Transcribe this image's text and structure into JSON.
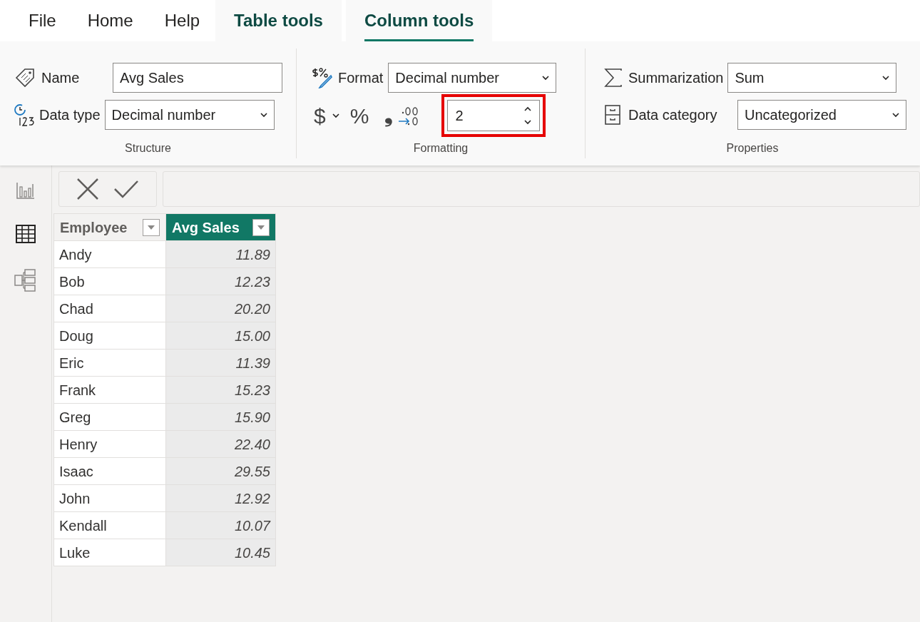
{
  "tabs": [
    {
      "label": "File",
      "selected": false,
      "kind": "normal"
    },
    {
      "label": "Home",
      "selected": false,
      "kind": "normal"
    },
    {
      "label": "Help",
      "selected": false,
      "kind": "normal"
    },
    {
      "label": "Table tools",
      "selected": false,
      "kind": "contextual"
    },
    {
      "label": "Column tools",
      "selected": true,
      "kind": "contextual"
    }
  ],
  "ribbon": {
    "structure": {
      "title": "Structure",
      "name_label": "Name",
      "name_value": "Avg Sales",
      "data_type_label": "Data type",
      "data_type_value": "Decimal number"
    },
    "formatting": {
      "title": "Formatting",
      "format_label": "Format",
      "format_value": "Decimal number",
      "currency_symbol": "$",
      "percent_symbol": "%",
      "comma_symbol": "❟",
      "decimal_places": "2",
      "decimal_places_highlighted": true
    },
    "properties": {
      "title": "Properties",
      "summarization_label": "Summarization",
      "summarization_value": "Sum",
      "data_category_label": "Data category",
      "data_category_value": "Uncategorized"
    }
  },
  "nav": [
    {
      "kind": "report",
      "selected": false
    },
    {
      "kind": "table",
      "selected": true
    },
    {
      "kind": "model",
      "selected": false
    }
  ],
  "table": {
    "columns": [
      {
        "label": "Employee",
        "selected": false
      },
      {
        "label": "Avg Sales",
        "selected": true
      }
    ],
    "rows": [
      [
        "Andy",
        "11.89"
      ],
      [
        "Bob",
        "12.23"
      ],
      [
        "Chad",
        "20.20"
      ],
      [
        "Doug",
        "15.00"
      ],
      [
        "Eric",
        "11.39"
      ],
      [
        "Frank",
        "15.23"
      ],
      [
        "Greg",
        "15.90"
      ],
      [
        "Henry",
        "22.40"
      ],
      [
        "Isaac",
        "29.55"
      ],
      [
        "John",
        "12.92"
      ],
      [
        "Kendall",
        "10.07"
      ],
      [
        "Luke",
        "10.45"
      ]
    ]
  }
}
